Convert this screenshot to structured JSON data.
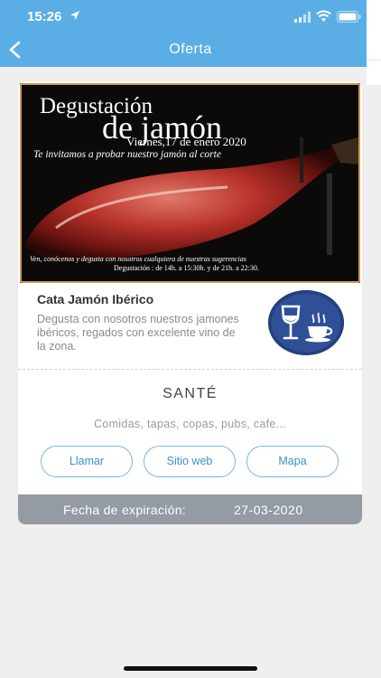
{
  "status_bar": {
    "time": "15:26",
    "icons": [
      "location-arrow-icon",
      "signal-icon",
      "wifi-icon",
      "battery-icon"
    ]
  },
  "header": {
    "title": "Oferta",
    "back_icon": "chevron-left-icon",
    "color": "#5aaee5"
  },
  "banner": {
    "line1": "Degustación",
    "line2": "de jamón",
    "date": "Viernes,17 de enero 2020",
    "invite": "Te invitamos a probar nuestro jamón al corte",
    "foot1": "Ven, conócenos y degusta con nosotros cualquiera de nuestras sugerencias",
    "foot2": "Degustación : de 14h. a 15:30h. y de 21h. a 22:30."
  },
  "offer": {
    "title": "Cata Jamón Ibérico",
    "description": "Degusta con nosotros nuestros jamones ibéricos, regados con excelente vino de la zona.",
    "category_icon": "wine-and-coffee-icon",
    "category_icon_color": "#2f4f97"
  },
  "shop": {
    "name": "SANTÉ",
    "categories": "Comidas, tapas, copas, pubs, cafe..."
  },
  "actions": {
    "call": "Llamar",
    "website": "Sitio web",
    "map": "Mapa"
  },
  "expiry": {
    "label": "Fecha de expiración:",
    "value": "27-03-2020"
  }
}
